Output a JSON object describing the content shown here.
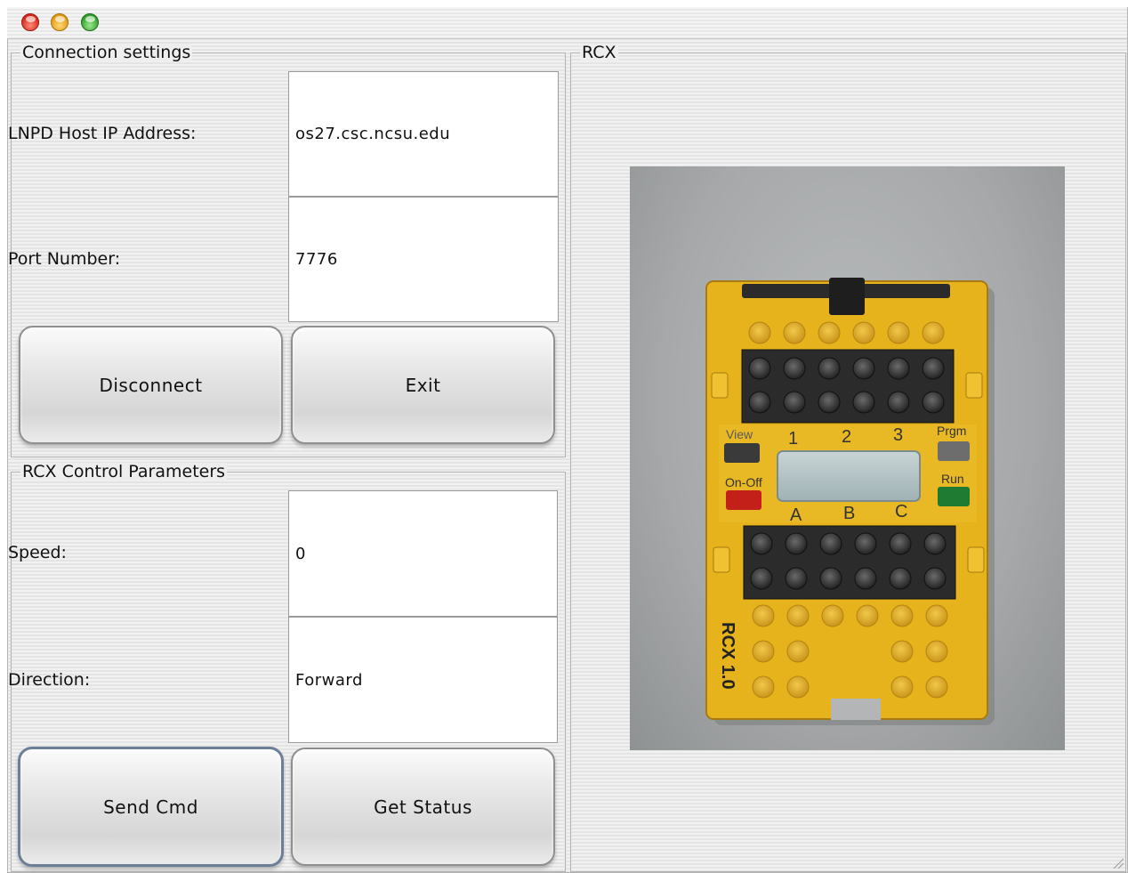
{
  "window": {
    "controls": [
      "close-button",
      "minimize-button",
      "zoom-button"
    ]
  },
  "connection": {
    "title": "Connection settings",
    "host_label": "LNPD Host IP Address:",
    "host_value": "os27.csc.ncsu.edu",
    "port_label": "Port Number:",
    "port_value": "7776",
    "disconnect_label": "Disconnect",
    "exit_label": "Exit"
  },
  "control": {
    "title": "RCX Control Parameters",
    "speed_label": "Speed:",
    "speed_value": "0",
    "direction_label": "Direction:",
    "direction_value": "Forward",
    "send_label": "Send Cmd",
    "status_label": "Get Status"
  },
  "rcx": {
    "title": "RCX",
    "photo": {
      "brick_text": "RCX 1.0",
      "view_label": "View",
      "prgm_label": "Prgm",
      "onoff_label": "On-Off",
      "run_label": "Run",
      "ports_top": [
        "1",
        "2",
        "3"
      ],
      "ports_bottom": [
        "A",
        "B",
        "C"
      ]
    }
  },
  "colors": {
    "window_stripe": "#ededed",
    "brick_yellow": "#e6b31c",
    "brick_black": "#2b2b2b",
    "button_border": "#8f8f8f",
    "focus_border": "#6c7f99"
  }
}
